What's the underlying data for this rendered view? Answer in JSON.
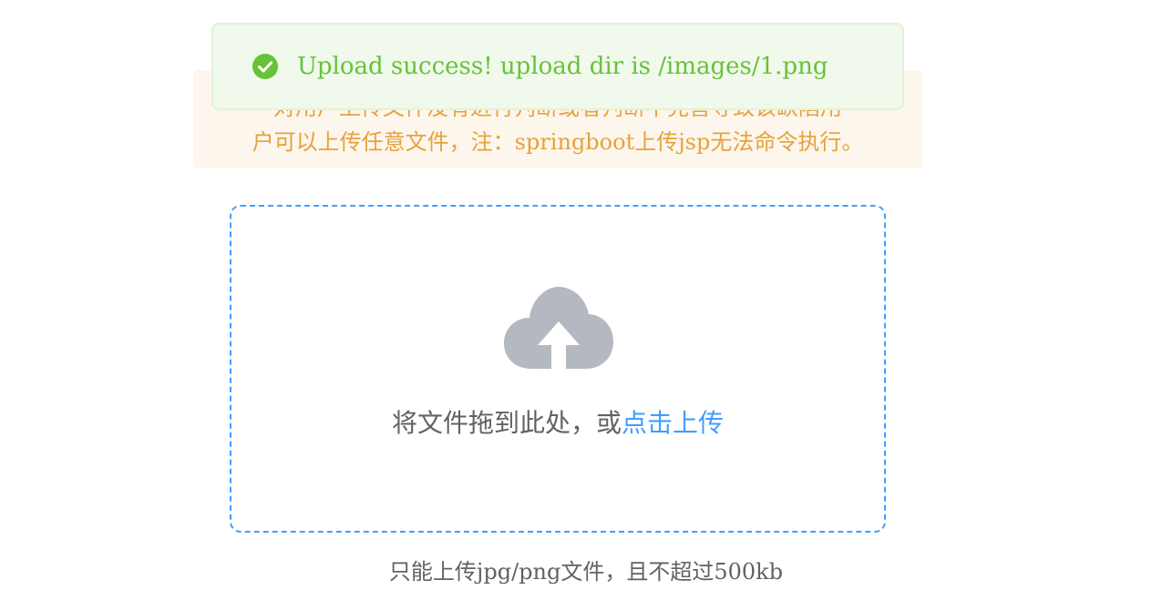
{
  "toast": {
    "message": "Upload success! upload dir is /images/1.png",
    "icon": "check-circle-icon",
    "color": "#67c23a",
    "background": "#f0f9eb"
  },
  "warning": {
    "line1": "对用户上传文件没有进行判断或者判断不完善导致该缺陷用",
    "line2": "户可以上传任意文件，注：springboot上传jsp无法命令执行。",
    "color": "#e6a23c",
    "background": "#fdf6ec"
  },
  "upload": {
    "icon": "cloud-upload-icon",
    "drop_text": "将文件拖到此处，或",
    "click_text": "点击上传",
    "tip": "只能上传jpg/png文件，且不超过500kb",
    "accent": "#409eff"
  }
}
